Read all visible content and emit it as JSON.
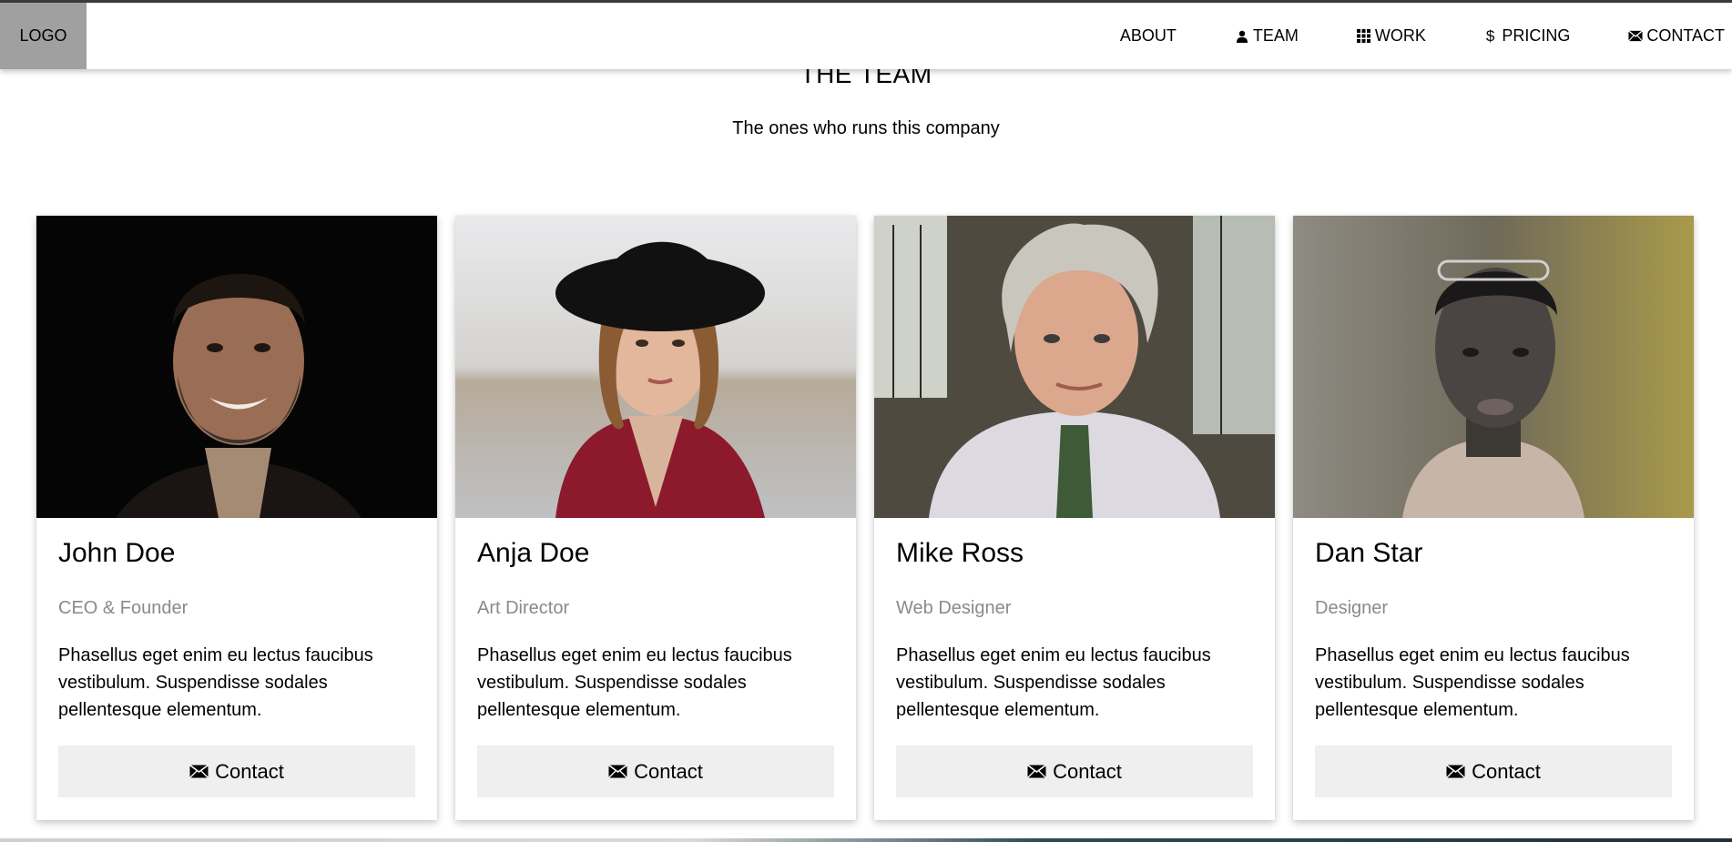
{
  "nav": {
    "logo": "LOGO",
    "links": [
      {
        "label": "ABOUT",
        "icon": ""
      },
      {
        "label": "TEAM",
        "icon": "user-icon"
      },
      {
        "label": "WORK",
        "icon": "grid-icon"
      },
      {
        "label": "PRICING",
        "icon": "dollar-icon"
      },
      {
        "label": "CONTACT",
        "icon": "envelope-icon"
      }
    ]
  },
  "section": {
    "title": "THE TEAM",
    "subtitle": "The ones who runs this company"
  },
  "team": [
    {
      "name": "John Doe",
      "role": "CEO & Founder",
      "bio": "Phasellus eget enim eu lectus faucibus vestibulum. Suspendisse sodales pellentesque elementum.",
      "button": "Contact"
    },
    {
      "name": "Anja Doe",
      "role": "Art Director",
      "bio": "Phasellus eget enim eu lectus faucibus vestibulum. Suspendisse sodales pellentesque elementum.",
      "button": "Contact"
    },
    {
      "name": "Mike Ross",
      "role": "Web Designer",
      "bio": "Phasellus eget enim eu lectus faucibus vestibulum. Suspendisse sodales pellentesque elementum.",
      "button": "Contact"
    },
    {
      "name": "Dan Star",
      "role": "Designer",
      "bio": "Phasellus eget enim eu lectus faucibus vestibulum. Suspendisse sodales pellentesque elementum.",
      "button": "Contact"
    }
  ],
  "colors": {
    "logo_bg": "#a0a0a0",
    "button_bg": "#efefef",
    "role_text": "#8a8a8a"
  }
}
